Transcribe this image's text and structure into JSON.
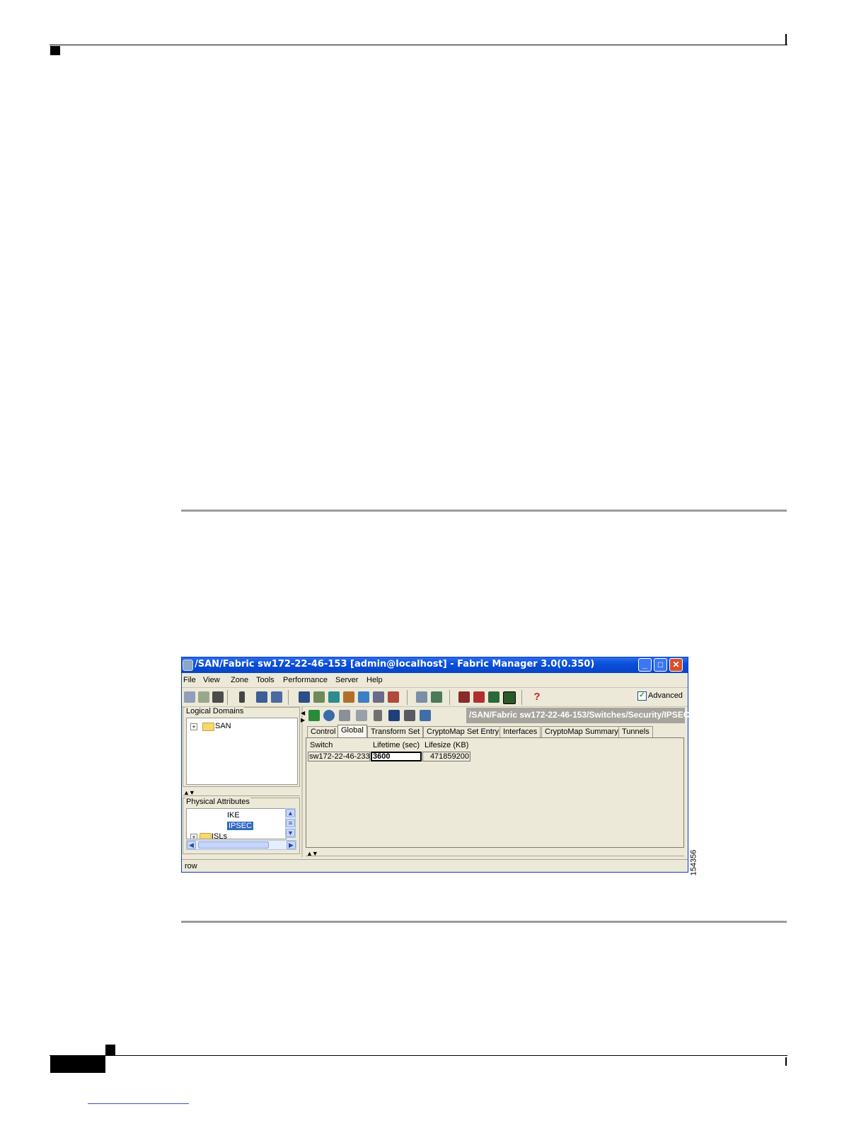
{
  "window": {
    "title": "/SAN/Fabric sw172-22-46-153 [admin@localhost] - Fabric Manager 3.0(0.350)",
    "buttons": {
      "minimize": "_",
      "maximize": "□",
      "close": "✕"
    }
  },
  "menu": [
    "File",
    "View",
    "Zone",
    "Tools",
    "Performance",
    "Server",
    "Help"
  ],
  "toolbar": {
    "advanced_label": "Advanced",
    "advanced_checked": true,
    "icons": [
      "open-icon",
      "discover-icon",
      "binoculars-icon",
      "server-icon",
      "lock-icon",
      "users-icon",
      "list-icon",
      "layers-icon",
      "flow-icon",
      "info-icon",
      "web-icon",
      "people-icon",
      "grid-icon",
      "network-icon",
      "device-icon",
      "tools-icon",
      "security-icon",
      "chart-icon",
      "monitor-icon",
      "help-icon"
    ]
  },
  "left_panel": {
    "logical_domains_label": "Logical Domains",
    "logical_tree": [
      {
        "expander": "+",
        "label": "SAN"
      }
    ],
    "physical_attributes_label": "Physical Attributes",
    "physical_tree": [
      {
        "label": "IKE",
        "selected": false
      },
      {
        "label": "IPSEC",
        "selected": true
      },
      {
        "expander": "+",
        "label": "ISLs"
      }
    ]
  },
  "right_panel": {
    "path": "/SAN/Fabric sw172-22-46-153/Switches/Security/IPSEC",
    "action_icons": [
      "apply-icon",
      "refresh-icon",
      "copy-icon",
      "export-icon",
      "undo-icon",
      "save-icon",
      "print-icon",
      "edit-icon"
    ],
    "tabs": [
      "Control",
      "Global",
      "Transform Set",
      "CryptoMap Set Entry",
      "Interfaces",
      "CryptoMap Summary",
      "Tunnels"
    ],
    "active_tab": "Global",
    "table": {
      "columns": [
        "Switch",
        "Lifetime (sec)",
        "Lifesize (KB)"
      ],
      "rows": [
        [
          "sw172-22-46-233",
          "3600",
          "471859200"
        ]
      ]
    }
  },
  "status_bar": {
    "text": "row"
  },
  "figure_id": "154356"
}
